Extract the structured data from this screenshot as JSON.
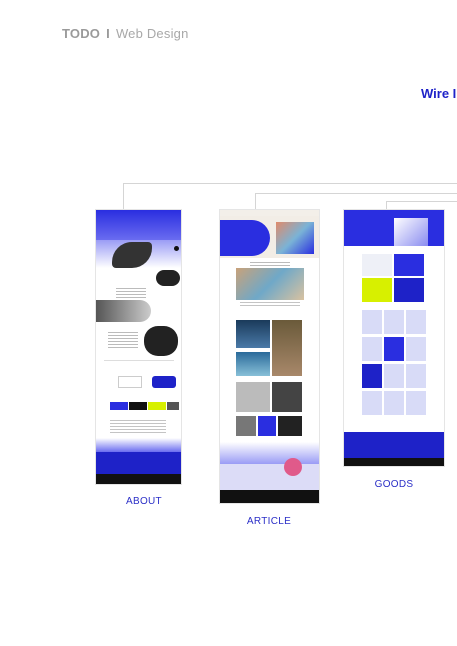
{
  "header": {
    "brand": "TODO",
    "separator": "I",
    "subtitle": "Web Design"
  },
  "section_title": "Wire I",
  "pages": [
    {
      "label": "ABOUT"
    },
    {
      "label": "ARTICLE"
    },
    {
      "label": "GOODS"
    }
  ],
  "colors": {
    "accent": "#1e22c8",
    "brand_blue": "#2a2ee0",
    "lime": "#d7f000",
    "dark": "#111111"
  }
}
